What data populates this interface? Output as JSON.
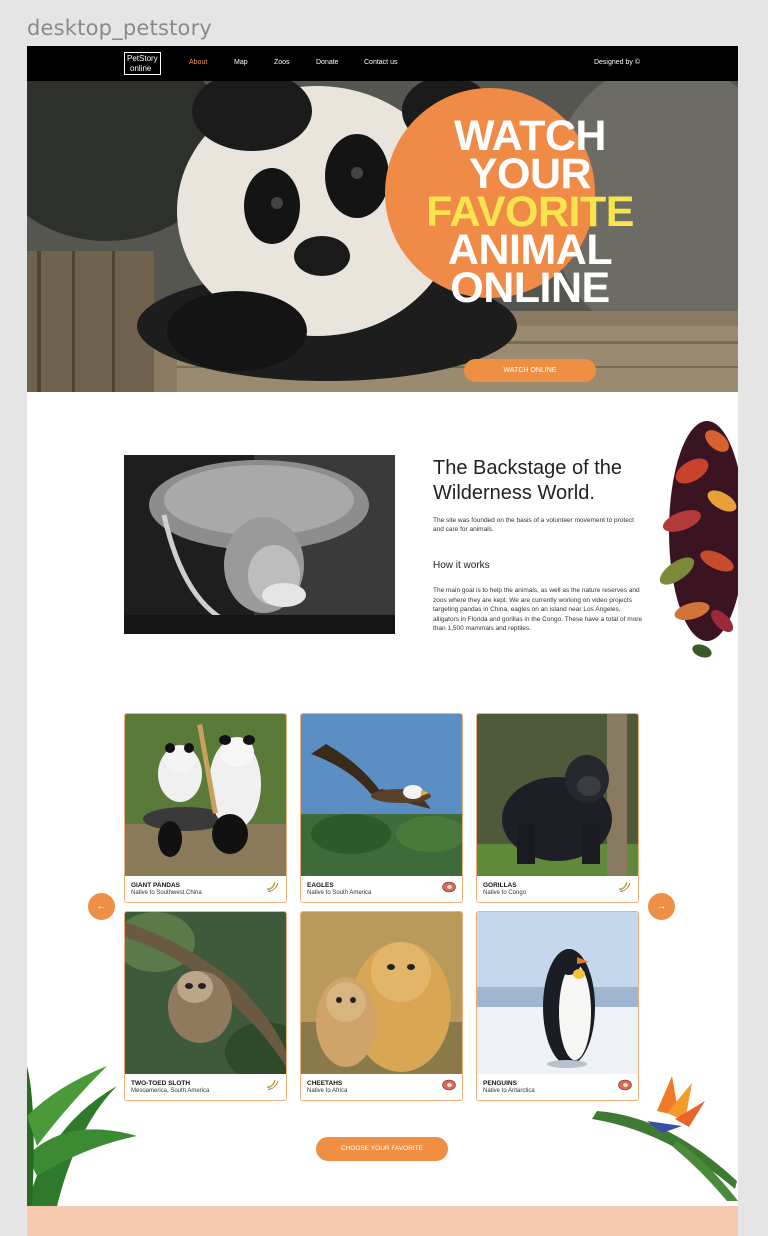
{
  "frame": {
    "label": "desktop_petstory"
  },
  "header": {
    "logo_line1": "PetStory",
    "logo_line2": "online",
    "nav": [
      "About",
      "Map",
      "Zoos",
      "Donate",
      "Contact us"
    ],
    "active_nav": "About",
    "designed_by": "Designed by ©"
  },
  "hero": {
    "title_lines": [
      "WATCH",
      "YOUR",
      "FAVORITE",
      "ANIMAL",
      "ONLINE"
    ],
    "button_label": "WATCH ONLINE"
  },
  "about": {
    "title": "The Backstage of the Wilderness World.",
    "subtitle": "The site was founded on the basis of a volunteer movement to protect and care for animals.",
    "how_title": "How it works",
    "how_text": "The main goal is to help the animals, as well as the nature reserves and zoos where they are kept. We are currently working on video projects targeting pandas in China, eagles on an island near Los Angeles, alligators in Florida and gorillas in the Congo. These have a total of more than 1,500 mammals and reptiles."
  },
  "animals": [
    {
      "name": "GIANT PANDAS",
      "native": "Native to Southwest China",
      "food_icon": "banana-icon"
    },
    {
      "name": "EAGLES",
      "native": "Native to South America",
      "food_icon": "meat-icon"
    },
    {
      "name": "GORILLAS",
      "native": "Native to Congo",
      "food_icon": "banana-icon"
    },
    {
      "name": "TWO-TOED SLOTH",
      "native": "Mesoamerica, South America",
      "food_icon": "banana-icon"
    },
    {
      "name": "CHEETAHS",
      "native": "Native to Africa",
      "food_icon": "meat-icon"
    },
    {
      "name": "PENGUINS",
      "native": "Native to Antarctica",
      "food_icon": "meat-icon"
    }
  ],
  "carousel": {
    "prev": "←",
    "next": "→"
  },
  "cta": {
    "choose_label": "CHOOSE YOUR FAVORITE"
  },
  "colors": {
    "accent": "#ef8f44",
    "highlight": "#f7e44e",
    "header": "#000000",
    "footer": "#f6c9b1"
  }
}
